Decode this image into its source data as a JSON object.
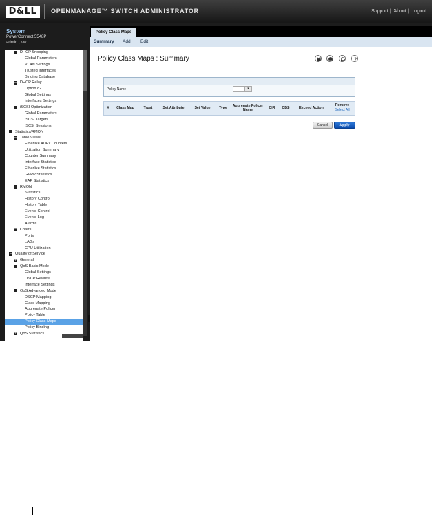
{
  "header": {
    "logo_text": "D&LL",
    "app_title": "OPENMANAGE™ SWITCH ADMINISTRATOR",
    "links": {
      "support": "Support",
      "about": "About",
      "logout": "Logout",
      "separator": "|"
    }
  },
  "sidebar": {
    "system_title": "System",
    "model": "PowerConnect 5548P",
    "user": "admin , r/w",
    "tree": [
      {
        "label": "DHCP Snooping",
        "level": 1,
        "toggle": "minus"
      },
      {
        "label": "Global Parameters",
        "level": 2
      },
      {
        "label": "VLAN Settings",
        "level": 2
      },
      {
        "label": "Trusted Interfaces",
        "level": 2
      },
      {
        "label": "Binding Database",
        "level": 2
      },
      {
        "label": "DHCP Relay",
        "level": 1,
        "toggle": "minus"
      },
      {
        "label": "Option 82",
        "level": 2
      },
      {
        "label": "Global Settings",
        "level": 2
      },
      {
        "label": "Interfaces Settings",
        "level": 2
      },
      {
        "label": "iSCSI Optimization",
        "level": 1,
        "toggle": "minus"
      },
      {
        "label": "Global Parameters",
        "level": 2
      },
      {
        "label": "iSCSI Targets",
        "level": 2
      },
      {
        "label": "iSCSI Sessions",
        "level": 2
      },
      {
        "label": "Statistics/RMON",
        "level": 0,
        "toggle": "minus"
      },
      {
        "label": "Table Views",
        "level": 1,
        "toggle": "minus"
      },
      {
        "label": "Etherlike ADEx Counters",
        "level": 2
      },
      {
        "label": "Utilization Summary",
        "level": 2
      },
      {
        "label": "Counter Summary",
        "level": 2
      },
      {
        "label": "Interface Statistics",
        "level": 2
      },
      {
        "label": "Etherlike Statistics",
        "level": 2
      },
      {
        "label": "GVRP Statistics",
        "level": 2
      },
      {
        "label": "EAP Statistics",
        "level": 2
      },
      {
        "label": "RMON",
        "level": 1,
        "toggle": "minus"
      },
      {
        "label": "Statistics",
        "level": 2
      },
      {
        "label": "History Control",
        "level": 2
      },
      {
        "label": "History Table",
        "level": 2
      },
      {
        "label": "Events Control",
        "level": 2
      },
      {
        "label": "Events Log",
        "level": 2
      },
      {
        "label": "Alarms",
        "level": 2
      },
      {
        "label": "Charts",
        "level": 1,
        "toggle": "minus"
      },
      {
        "label": "Ports",
        "level": 2
      },
      {
        "label": "LAGs",
        "level": 2
      },
      {
        "label": "CPU Utilization",
        "level": 2
      },
      {
        "label": "Quality of Service",
        "level": 0,
        "toggle": "minus"
      },
      {
        "label": "General",
        "level": 1,
        "toggle": "plus"
      },
      {
        "label": "QoS Basic Mode",
        "level": 1,
        "toggle": "minus"
      },
      {
        "label": "Global Settings",
        "level": 2
      },
      {
        "label": "DSCP Rewrite",
        "level": 2
      },
      {
        "label": "Interface Settings",
        "level": 2
      },
      {
        "label": "QoS Advanced Mode",
        "level": 1,
        "toggle": "minus"
      },
      {
        "label": "DSCP Mapping",
        "level": 2
      },
      {
        "label": "Class Mapping",
        "level": 2
      },
      {
        "label": "Aggregate Policer",
        "level": 2
      },
      {
        "label": "Policy Table",
        "level": 2
      },
      {
        "label": "Policy Class Maps",
        "level": 2,
        "selected": true
      },
      {
        "label": "Policy Binding",
        "level": 2
      },
      {
        "label": "QoS Statistics",
        "level": 1,
        "toggle": "plus"
      }
    ]
  },
  "main": {
    "active_tab": "Policy Class Maps",
    "subnav": {
      "summary": "Summary",
      "add": "Add",
      "edit": "Edit"
    },
    "page_title": "Policy Class Maps : Summary",
    "toolbar_icons": [
      "save-icon",
      "print-icon",
      "refresh-icon",
      "help-icon"
    ],
    "filter": {
      "label": "Policy Name",
      "selected_value": ""
    },
    "table": {
      "columns": [
        "#",
        "Class Map",
        "Trust",
        "Set Attribute",
        "Set Value",
        "Type",
        "Aggregate Policer Name",
        "CIR",
        "CBS",
        "Exceed Action",
        "Remove"
      ],
      "select_all": "Select All",
      "rows": []
    },
    "buttons": {
      "cancel": "Cancel",
      "apply": "Apply"
    }
  },
  "colors": {
    "header_bg": "#1e1e1e",
    "sidebar_bg": "#1c1c1c",
    "selected_item": "#5aa2e6",
    "subnav_bg": "#d9e5f1",
    "apply_button": "#1a5fc4"
  }
}
